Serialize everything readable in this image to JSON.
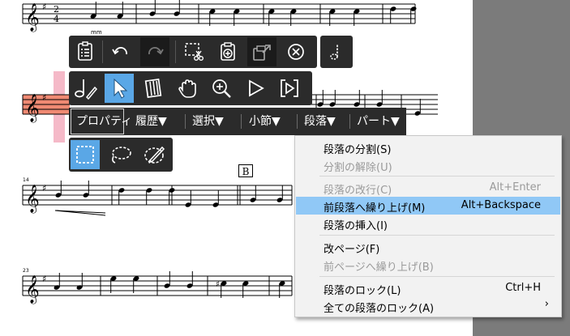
{
  "score": {
    "time_signature_top": "2",
    "time_signature_bottom": "4",
    "clef_glyph": "𝄞",
    "rehearsal_mark": "B",
    "system_numbers": [
      "14",
      "23"
    ],
    "selected_measure_color": "#f08a73",
    "selected_measure_highlight": "#f5b9c8"
  },
  "toolbar_top": {
    "buttons": [
      {
        "name": "properties-list-icon"
      },
      {
        "name": "undo-icon"
      },
      {
        "name": "redo-icon"
      },
      {
        "name": "cut-selection-icon"
      },
      {
        "name": "paste-icon"
      },
      {
        "name": "export-icon"
      },
      {
        "name": "delete-icon"
      },
      {
        "name": "note-tool-icon"
      }
    ]
  },
  "toolbar_mid": {
    "buttons": [
      {
        "name": "note-edit-icon"
      },
      {
        "name": "pointer-icon"
      },
      {
        "name": "measure-select-icon"
      },
      {
        "name": "hand-icon"
      },
      {
        "name": "zoom-icon"
      },
      {
        "name": "play-icon"
      },
      {
        "name": "play-from-icon"
      }
    ]
  },
  "menubar": {
    "items": [
      {
        "label": "プロパティ"
      },
      {
        "label": "履歴▼"
      },
      {
        "label": "選択▼"
      },
      {
        "label": "小節▼"
      },
      {
        "label": "段落▼"
      },
      {
        "label": "パート▼"
      }
    ]
  },
  "toolbar_select": {
    "buttons": [
      {
        "name": "rect-select-icon"
      },
      {
        "name": "lasso-select-icon"
      },
      {
        "name": "brush-select-icon"
      }
    ]
  },
  "context_menu": {
    "items": [
      {
        "label": "段落の分割(S)",
        "shortcut": "",
        "disabled": false,
        "highlighted": false
      },
      {
        "label": "分割の解除(U)",
        "shortcut": "",
        "disabled": true,
        "highlighted": false
      },
      {
        "label": "段落の改行(C)",
        "shortcut": "Alt+Enter",
        "disabled": true,
        "highlighted": false
      },
      {
        "label": "前段落へ繰り上げ(M)",
        "shortcut": "Alt+Backspace",
        "disabled": false,
        "highlighted": true
      },
      {
        "label": "段落の挿入(I)",
        "shortcut": "",
        "disabled": false,
        "highlighted": false
      },
      {
        "label": "改ページ(F)",
        "shortcut": "",
        "disabled": false,
        "highlighted": false
      },
      {
        "label": "前ページへ繰り上げ(B)",
        "shortcut": "",
        "disabled": true,
        "highlighted": false
      },
      {
        "label": "段落のロック(L)",
        "shortcut": "Ctrl+H",
        "disabled": false,
        "highlighted": false
      },
      {
        "label": "全ての段落のロック(A)",
        "shortcut": "",
        "disabled": false,
        "highlighted": false,
        "submenu": "›"
      }
    ]
  },
  "colors": {
    "toolbar_bg": "#2b2b2b",
    "active_button": "#5aa7e6",
    "menu_highlight": "#90c8f6",
    "side_panel": "#7b7b7b"
  }
}
